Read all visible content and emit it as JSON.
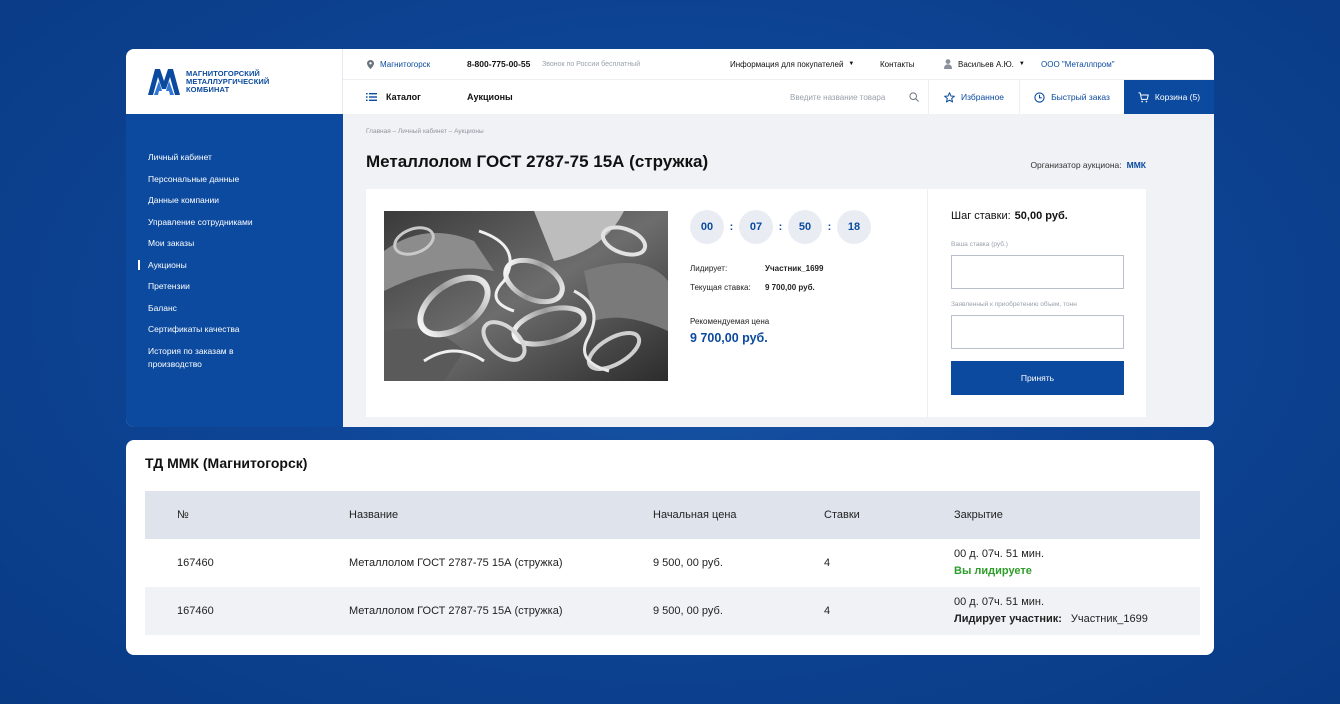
{
  "brand": {
    "line1": "МАГНИТОГОРСКИЙ",
    "line2": "МЕТАЛЛУРГИЧЕСКИЙ",
    "line3": "КОМБИНАТ"
  },
  "topbar": {
    "city": "Магнитогорск",
    "phone": "8-800-775-00-55",
    "phone_note": "Звонок по России бесплатный",
    "buyers_info": "Информация для покупателей",
    "contacts": "Контакты",
    "user": "Васильев А.Ю.",
    "company": "ООО \"Металлпром\""
  },
  "navbar": {
    "catalog": "Каталог",
    "auctions": "Аукционы",
    "search_placeholder": "Введите название товара",
    "favorites": "Избранное",
    "quick_order": "Быстрый заказ",
    "cart": "Корзина (5)"
  },
  "sidebar": {
    "items": [
      {
        "label": "Личный кабинет"
      },
      {
        "label": "Персональные данные"
      },
      {
        "label": "Данные компании"
      },
      {
        "label": "Управление сотрудниками"
      },
      {
        "label": "Мои заказы"
      },
      {
        "label": "Аукционы"
      },
      {
        "label": "Претензии"
      },
      {
        "label": "Баланс"
      },
      {
        "label": "Сертификаты качества"
      },
      {
        "label": "История по заказам в производство"
      }
    ],
    "active_index": 5
  },
  "main": {
    "breadcrumb": "Главная – Личный кабинет – Аукционы",
    "title": "Металлолом ГОСТ 2787-75 15А (стружка)",
    "organizer_label": "Организатор аукциона:",
    "organizer_value": "ММК"
  },
  "lot": {
    "timer": [
      "00",
      "07",
      "50",
      "18"
    ],
    "timer_sep": ":",
    "leader_label": "Лидирует:",
    "leader_value": "Участник_1699",
    "current_bid_label": "Текущая ставка:",
    "current_bid_value": "9 700,00 руб.",
    "recommended_label": "Рекомендуемая цена",
    "recommended_value": "9 700,00 руб."
  },
  "bid": {
    "step_label": "Шаг ставки:",
    "step_value": "50,00 руб.",
    "your_bid_label": "Ваша ставка (руб.)",
    "your_bid_value": "",
    "volume_label": "Заявленный к приобретению объем, тонн",
    "volume_value": "",
    "accept": "Принять"
  },
  "table": {
    "title": "ТД ММК (Магнитогорск)",
    "headers": [
      "№",
      "Название",
      "Начальная цена",
      "Ставки",
      "Закрытие"
    ],
    "rows": [
      {
        "num": "167460",
        "name": "Металлолом ГОСТ 2787-75 15А (стружка)",
        "start_price": "9 500, 00 руб.",
        "bids": "4",
        "close_time": "00 д. 07ч. 51 мин.",
        "status": "Вы лидируете"
      },
      {
        "num": "167460",
        "name": "Металлолом ГОСТ 2787-75 15А (стружка)",
        "start_price": "9 500, 00 руб.",
        "bids": "4",
        "close_time": "00 д. 07ч. 51 мин.",
        "leader_label": "Лидирует участник:",
        "leader_value": "Участник_1699"
      }
    ]
  },
  "colors": {
    "brand_blue": "#0b4a9f",
    "background_blue": "#0e4596",
    "leading_green": "#2e9e2a"
  }
}
